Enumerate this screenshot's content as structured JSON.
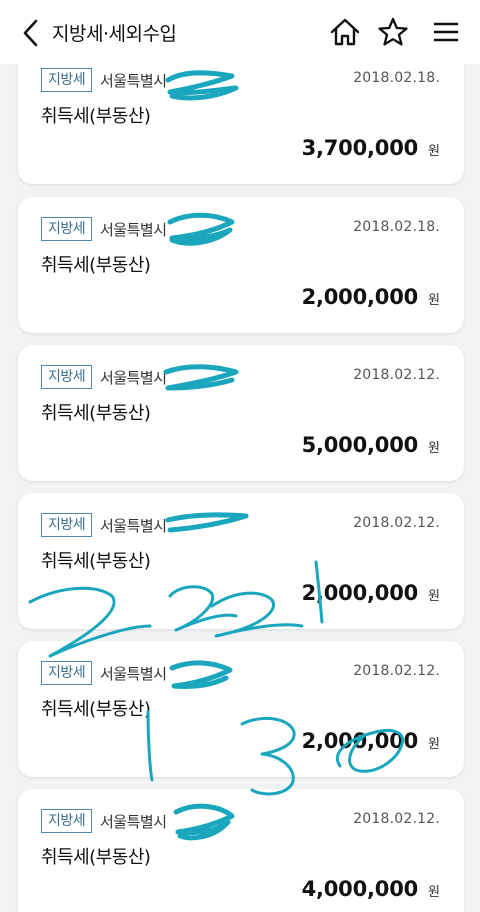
{
  "header": {
    "title": "지방세·세외수입"
  },
  "icons": {
    "back": "chevron-left-icon",
    "home": "home-icon",
    "favorite": "star-outline-icon",
    "menu": "hamburger-menu-icon"
  },
  "cards": [
    {
      "badge": "지방세",
      "org": "서울특별시",
      "date": "2018.02.18.",
      "tax": "취득세(부동산)",
      "amount": "3,700,000",
      "unit": "원"
    },
    {
      "badge": "지방세",
      "org": "서울특별시",
      "date": "2018.02.18.",
      "tax": "취득세(부동산)",
      "amount": "2,000,000",
      "unit": "원"
    },
    {
      "badge": "지방세",
      "org": "서울특별시",
      "date": "2018.02.12.",
      "tax": "취득세(부동산)",
      "amount": "5,000,000",
      "unit": "원"
    },
    {
      "badge": "지방세",
      "org": "서울특별시",
      "date": "2018.02.12.",
      "tax": "취득세(부동산)",
      "amount": "2,000,000",
      "unit": "원"
    },
    {
      "badge": "지방세",
      "org": "서울특별시",
      "date": "2018.02.12.",
      "tax": "취득세(부동산)",
      "amount": "2,000,000",
      "unit": "원"
    },
    {
      "badge": "지방세",
      "org": "서울특별시",
      "date": "2018.02.12.",
      "tax": "취득세(부동산)",
      "amount": "4,000,000",
      "unit": "원"
    }
  ],
  "colors": {
    "annotation_ink": "#1aa6bd",
    "badge_border": "#4f87a8",
    "background": "#f2f3f5"
  }
}
